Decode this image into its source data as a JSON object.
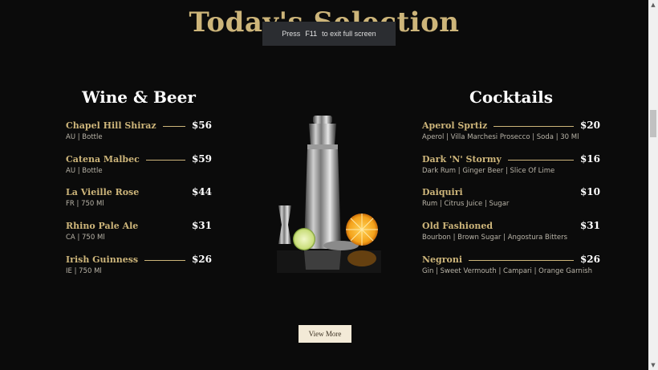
{
  "page": {
    "title": "Today's Selection",
    "fullscreen_toast": {
      "prefix": "Press",
      "key": "F11",
      "suffix": "to exit full screen"
    },
    "view_more_label": "View More"
  },
  "wine_beer": {
    "heading": "Wine & Beer",
    "items": [
      {
        "name": "Chapel Hill Shiraz",
        "price": "$56",
        "desc": "AU | Bottle",
        "line": true
      },
      {
        "name": "Catena Malbec",
        "price": "$59",
        "desc": "AU | Bottle",
        "line": true
      },
      {
        "name": "La Vieille Rose",
        "price": "$44",
        "desc": "FR | 750 Ml",
        "line": false
      },
      {
        "name": "Rhino Pale Ale",
        "price": "$31",
        "desc": "CA | 750 Ml",
        "line": false
      },
      {
        "name": "Irish Guinness",
        "price": "$26",
        "desc": "IE | 750 Ml",
        "line": true
      }
    ]
  },
  "cocktails": {
    "heading": "Cocktails",
    "items": [
      {
        "name": "Aperol Sprtiz",
        "price": "$20",
        "desc": "Aperol | Villa Marchesi Prosecco | Soda | 30 Ml",
        "line": true
      },
      {
        "name": "Dark 'N' Stormy",
        "price": "$16",
        "desc": "Dark Rum | Ginger Beer | Slice Of Lime",
        "line": true
      },
      {
        "name": "Daiquiri",
        "price": "$10",
        "desc": "Rum | Citrus Juice | Sugar",
        "line": false
      },
      {
        "name": "Old Fashioned",
        "price": "$31",
        "desc": "Bourbon | Brown Sugar | Angostura Bitters",
        "line": false
      },
      {
        "name": "Negroni",
        "price": "$26",
        "desc": "Gin | Sweet Vermouth | Campari | Orange Garnish",
        "line": true
      }
    ]
  },
  "colors": {
    "background": "#0b0b0b",
    "gold": "#cdb57a",
    "button": "#f3ead7"
  },
  "icons": {
    "scroll_up": "triangle-up-icon",
    "scroll_down": "triangle-down-icon"
  }
}
